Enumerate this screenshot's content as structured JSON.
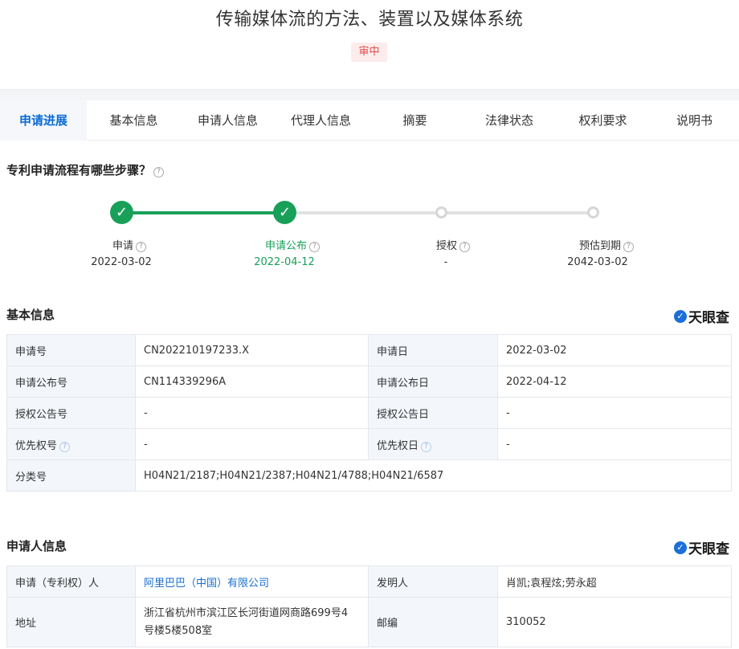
{
  "header": {
    "title": "传输媒体流的方法、装置以及媒体系统",
    "status": "审中"
  },
  "tabs": [
    "申请进展",
    "基本信息",
    "申请人信息",
    "代理人信息",
    "摘要",
    "法律状态",
    "权利要求",
    "说明书"
  ],
  "progress": {
    "title": "专利申请流程有哪些步骤？",
    "steps": [
      {
        "label": "申请",
        "date": "2022-03-02",
        "state": "done"
      },
      {
        "label": "申请公布",
        "date": "2022-04-12",
        "state": "current"
      },
      {
        "label": "授权",
        "date": "-",
        "state": "pending"
      },
      {
        "label": "预估到期",
        "date": "2042-03-02",
        "state": "pending"
      }
    ]
  },
  "brand": "天眼查",
  "basic_info": {
    "title": "基本信息",
    "rows": [
      {
        "l1": "申请号",
        "v1": "CN202210197233.X",
        "l2": "申请日",
        "v2": "2022-03-02"
      },
      {
        "l1": "申请公布号",
        "v1": "CN114339296A",
        "l2": "申请公布日",
        "v2": "2022-04-12"
      },
      {
        "l1": "授权公告号",
        "v1": "-",
        "l2": "授权公告日",
        "v2": "-"
      },
      {
        "l1": "优先权号",
        "v1": "-",
        "l2": "优先权日",
        "v2": "-"
      },
      {
        "l1": "分类号",
        "v1": "H04N21/2187;H04N21/2387;H04N21/4788;H04N21/6587"
      }
    ]
  },
  "applicant_info": {
    "title": "申请人信息",
    "rows": [
      {
        "l1": "申请（专利权）人",
        "v1": "阿里巴巴（中国）有限公司",
        "l2": "发明人",
        "v2": "肖凯;袁程炫;劳永超"
      },
      {
        "l1": "地址",
        "v1a": "浙江省杭州市滨江区长河街道网商路699号4",
        "v1b": "号楼5楼508室",
        "l2": "邮编",
        "v2": "310052"
      }
    ]
  },
  "colors": {
    "accent": "#0a6cd4",
    "done": "#18a058",
    "status": "#e24c4c"
  }
}
